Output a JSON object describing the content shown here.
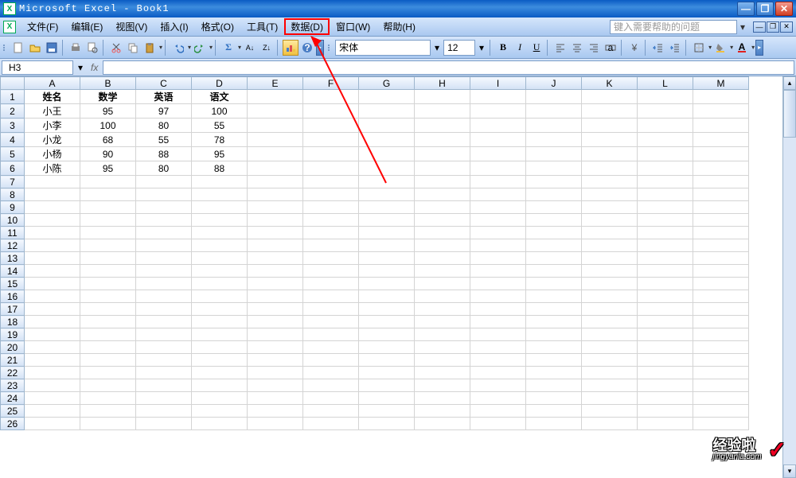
{
  "title": "Microsoft Excel - Book1",
  "menus": {
    "file": "文件(F)",
    "edit": "编辑(E)",
    "view": "视图(V)",
    "insert": "插入(I)",
    "format": "格式(O)",
    "tools": "工具(T)",
    "data": "数据(D)",
    "window": "窗口(W)",
    "help": "帮助(H)"
  },
  "help_placeholder": "键入需要帮助的问题",
  "font": {
    "name": "宋体",
    "size": "12"
  },
  "name_box": "H3",
  "columns": [
    "A",
    "B",
    "C",
    "D",
    "E",
    "F",
    "G",
    "H",
    "I",
    "J",
    "K",
    "L",
    "M"
  ],
  "row_count": 26,
  "headers": [
    "姓名",
    "数学",
    "英语",
    "语文"
  ],
  "rows": [
    [
      "小王",
      "95",
      "97",
      "100"
    ],
    [
      "小李",
      "100",
      "80",
      "55"
    ],
    [
      "小龙",
      "68",
      "55",
      "78"
    ],
    [
      "小杨",
      "90",
      "88",
      "95"
    ],
    [
      "小陈",
      "95",
      "80",
      "88"
    ]
  ],
  "watermark": {
    "line1": "经验啦",
    "line2": "jingyanla.com",
    "check": "✓"
  },
  "icons": {
    "bold": "B",
    "italic": "I",
    "underline": "U",
    "sigma": "Σ",
    "sort_asc": "A↓",
    "sort_desc": "Z↓",
    "help": "?",
    "chart": "▮"
  }
}
